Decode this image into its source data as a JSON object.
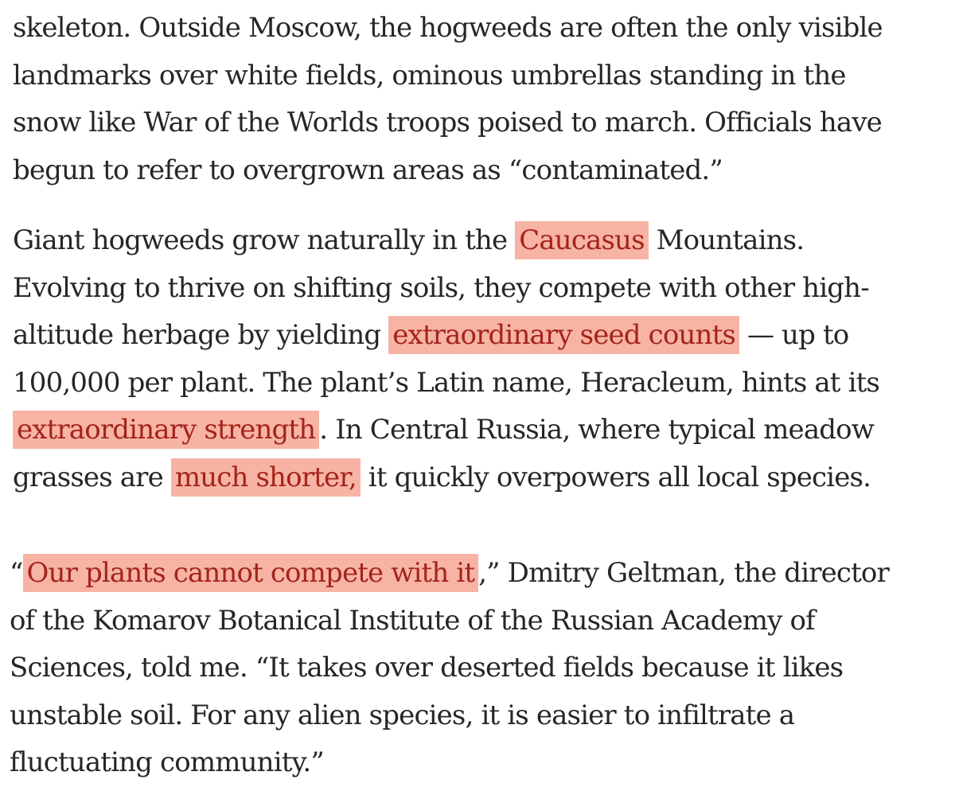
{
  "article": {
    "paragraphs": [
      {
        "lines": [
          [
            {
              "text": "skeleton. Outside Moscow, the hogweeds are often the only visible"
            }
          ],
          [
            {
              "text": "landmarks over white fields, ominous umbrellas standing in the"
            }
          ],
          [
            {
              "text": "snow like War of the Worlds troops poised to march. Officials have"
            }
          ],
          [
            {
              "text": "begun to refer to overgrown areas as “contaminated.”"
            }
          ]
        ]
      },
      {
        "lines": [
          [
            {
              "text": "Giant hogweeds grow naturally in the "
            },
            {
              "text": "Caucasus",
              "highlight": true
            },
            {
              "text": " Mountains."
            }
          ],
          [
            {
              "text": "Evolving to thrive on shifting soils, they compete with other high-"
            }
          ],
          [
            {
              "text": "altitude herbage by yielding "
            },
            {
              "text": "extraordinary seed counts",
              "highlight": true
            },
            {
              "text": " — up to"
            }
          ],
          [
            {
              "text": "100,000 per plant. The plant’s Latin name, Heracleum, hints at its"
            }
          ],
          [
            {
              "text": "extraordinary strength",
              "highlight": true
            },
            {
              "text": ". In Central Russia, where typical meadow"
            }
          ],
          [
            {
              "text": "grasses are "
            },
            {
              "text": "much shorter,",
              "highlight": true
            },
            {
              "text": " it quickly overpowers all local species."
            }
          ]
        ]
      },
      {
        "lines": [
          [
            {
              "text": "“"
            },
            {
              "text": "Our plants cannot compete with it",
              "highlight": true
            },
            {
              "text": ",” Dmitry Geltman, the director"
            }
          ],
          [
            {
              "text": "of the Komarov Botanical Institute of the Russian Academy of"
            }
          ],
          [
            {
              "text": "Sciences, told me. “It takes over deserted fields because it likes"
            }
          ],
          [
            {
              "text": "unstable soil. For any alien species, it is easier to infiltrate a"
            }
          ],
          [
            {
              "text": "fluctuating community.”"
            }
          ]
        ]
      }
    ]
  },
  "colors": {
    "text": "#262626",
    "highlight_background": "#f7b3a4",
    "highlight_text": "#a3241a",
    "page_background": "#ffffff"
  }
}
